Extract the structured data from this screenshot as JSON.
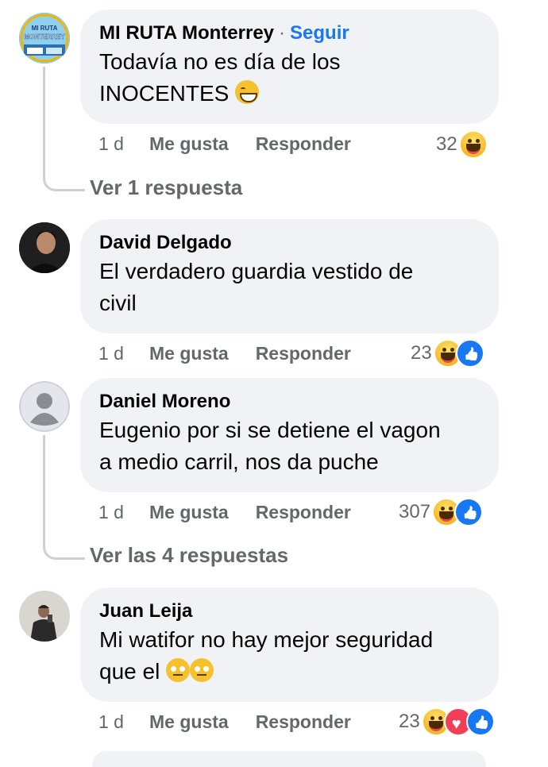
{
  "comments": [
    {
      "author": "MI RUTA Monterrey",
      "follow_label": "Seguir",
      "separator": "·",
      "text_line1": "Todavía no es día de los",
      "text_line2": "INOCENTES",
      "time": "1 d",
      "like_label": "Me gusta",
      "reply_label": "Responder",
      "reaction_count": "32",
      "reactions": [
        "haha"
      ],
      "view_replies": "Ver 1 respuesta",
      "avatar_text": [
        "MI RUTA",
        "MONTERREY"
      ]
    },
    {
      "author": "David Delgado",
      "text_line1": "El verdadero guardia vestido de",
      "text_line2": "civil",
      "time": "1 d",
      "like_label": "Me gusta",
      "reply_label": "Responder",
      "reaction_count": "23",
      "reactions": [
        "haha",
        "like"
      ]
    },
    {
      "author": "Daniel Moreno",
      "text_line1": "Eugenio por si se detiene el vagon",
      "text_line2": "a medio carril, nos da puche",
      "time": "1 d",
      "like_label": "Me gusta",
      "reply_label": "Responder",
      "reaction_count": "307",
      "reactions": [
        "haha",
        "like"
      ],
      "view_replies": "Ver las 4 respuestas"
    },
    {
      "author": "Juan Leija",
      "text_line1": "Mi watifor no hay mejor seguridad",
      "text_line2": "que el",
      "time": "1 d",
      "like_label": "Me gusta",
      "reply_label": "Responder",
      "reaction_count": "23",
      "reactions": [
        "haha",
        "love",
        "like"
      ]
    }
  ],
  "colors": {
    "bubble": "#f0f2f5",
    "secondary_text": "#65676b",
    "link_blue": "#1877f2"
  }
}
